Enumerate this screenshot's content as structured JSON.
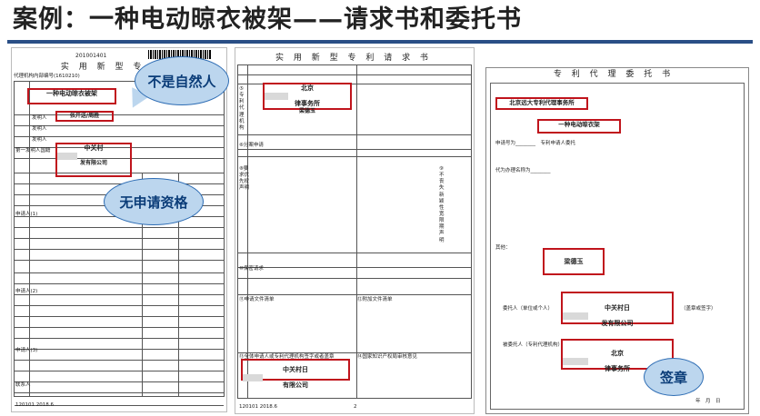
{
  "title": "案例：一种电动晾衣被架——请求书和委托书",
  "doc1": {
    "head": "实 用 新 型 专 利 请",
    "code": "201001401",
    "agency_line": "代理机构内部编号(1610210)",
    "invention_name": "一种电动晾衣被架",
    "inventor": "张开送/周胜",
    "applicant_name": "中关村",
    "applicant_sub": "发有限公司",
    "rows": [
      "发明人",
      "发明人",
      "发明人",
      "第一发明人国籍",
      "申请人(1)",
      "申请人(2)",
      "申请人(3)",
      "联系人"
    ],
    "footer": "120101\n2018.6"
  },
  "doc2": {
    "head": "实 用 新 型 专 利 请 求 书",
    "agency_name": "北京",
    "agency_suffix": "律事务所",
    "agent_name": "梁德玉",
    "bottom_name": "中关村日",
    "bottom_suffix": "有限公司",
    "sections": [
      "⑤专利代理机构",
      "⑥分案申请",
      "⑧要求优先权声明",
      "⑨不丧失新颖性宽限期声明",
      "⑩保密请求",
      "⑪申请文件清单",
      "⑫附加文件清单",
      "⑬全体申请人或专利代理机构签字或者盖章",
      "⑭国家知识产权局审核意见"
    ],
    "footer": "120101\n2018.6",
    "page": "2"
  },
  "doc3": {
    "head": "专 利 代 理 委 托 书",
    "agency_name": "北京远大专利代理事务所",
    "invention_name": "一种电动晾衣架",
    "agent_name": "梁德玉",
    "client_label": "委托人（单位或个人）",
    "client_name": "中关村日",
    "client_suffix": "发有限公司",
    "seal_label": "（盖章或签字）",
    "agency_label": "被委托人（专利代理机构）",
    "agency_sign": "北京",
    "agency_sign_suffix": "律事务所",
    "date": "年　月　日"
  },
  "callouts": {
    "not_natural": "不是自然人",
    "no_qualification": "无申请资格",
    "seal": "签章"
  }
}
